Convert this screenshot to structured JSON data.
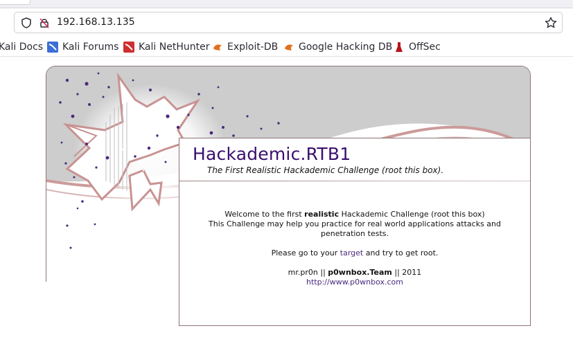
{
  "browser": {
    "url": "192.168.13.135",
    "bookmarks": [
      {
        "label": "Kali Docs",
        "icon": "kali-docs-icon"
      },
      {
        "label": "Kali Forums",
        "icon": "kali-forums-icon"
      },
      {
        "label": "Kali NetHunter",
        "icon": "kali-nethunter-icon"
      },
      {
        "label": "Exploit-DB",
        "icon": "exploit-db-icon"
      },
      {
        "label": "Google Hacking DB",
        "icon": "google-hacking-db-icon"
      },
      {
        "label": "OffSec",
        "icon": "offsec-icon"
      }
    ]
  },
  "page": {
    "title": "Hackademic.RTB1",
    "subtitle": "The First Realistic Hackademic Challenge (root this box).",
    "welcome_pre": "Welcome to the first ",
    "welcome_bold": "realistic",
    "welcome_post": " Hackademic Challenge (root this box)",
    "line2": "This Challenge may help you practice for real world applications attacks and penetration tests.",
    "goto_pre": "Please go to your ",
    "goto_link": "target",
    "goto_post": " and try to get root.",
    "credit_name": "mr.pr0n",
    "credit_sep1": " || ",
    "credit_team": "p0wnbox.Team",
    "credit_sep2": " || 2011",
    "site_link": "http://www.p0wnbox.com"
  },
  "colors": {
    "title": "#3a0f6e",
    "link": "#4b2a7e",
    "border": "#8d7373",
    "splash": "#cc9a9a",
    "dots": "#4b2a7e"
  }
}
